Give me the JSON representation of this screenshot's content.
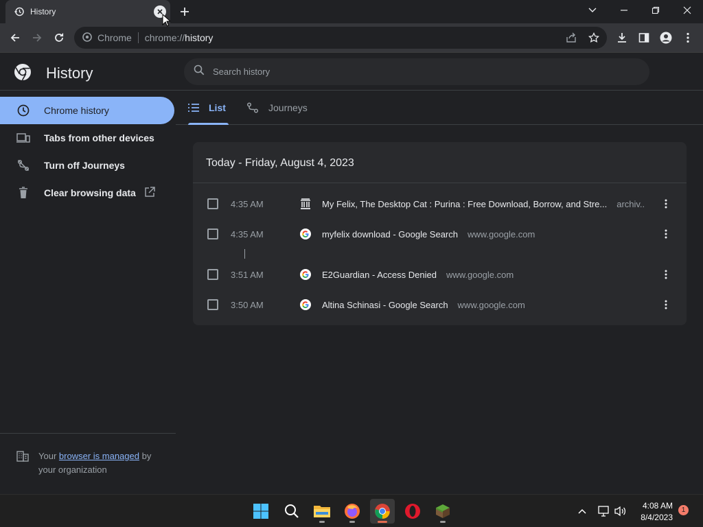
{
  "browser": {
    "tab_title": "History",
    "omnibox": {
      "site_name": "Chrome",
      "url_scheme": "chrome://",
      "url_path": "history"
    }
  },
  "page": {
    "title": "History",
    "search_placeholder": "Search history"
  },
  "sidebar": {
    "items": [
      {
        "label": "Chrome history",
        "icon": "clock-icon",
        "active": true
      },
      {
        "label": "Tabs from other devices",
        "icon": "devices-icon",
        "active": false
      },
      {
        "label": "Turn off Journeys",
        "icon": "journeys-off-icon",
        "active": false
      },
      {
        "label": "Clear browsing data",
        "icon": "trash-icon",
        "active": false
      }
    ],
    "managed": {
      "prefix": "Your",
      "link": "browser is managed",
      "suffix": "by your organization"
    }
  },
  "content_tabs": [
    {
      "label": "List",
      "icon": "list-icon",
      "active": true
    },
    {
      "label": "Journeys",
      "icon": "journeys-icon",
      "active": false
    }
  ],
  "history": {
    "date_header": "Today - Friday, August 4, 2023",
    "entries": [
      {
        "time": "4:35 AM",
        "favicon": "archive-icon",
        "title": "My Felix, The Desktop Cat : Purina : Free Download, Borrow, and Stre...",
        "domain": "archiv..."
      },
      {
        "time": "4:35 AM",
        "favicon": "google-icon",
        "title": "myfelix download - Google Search",
        "domain": "www.google.com"
      },
      {
        "time": "3:51 AM",
        "favicon": "google-icon",
        "title": "E2Guardian - Access Denied",
        "domain": "www.google.com"
      },
      {
        "time": "3:50 AM",
        "favicon": "google-icon",
        "title": "Altina Schinasi - Google Search",
        "domain": "www.google.com"
      }
    ]
  },
  "taskbar": {
    "clock_time": "4:08 AM",
    "clock_date": "8/4/2023",
    "notification_count": "1"
  },
  "colors": {
    "accent": "#8ab4f8",
    "background": "#202124",
    "card": "#292a2d",
    "notification": "#f47c6a"
  }
}
